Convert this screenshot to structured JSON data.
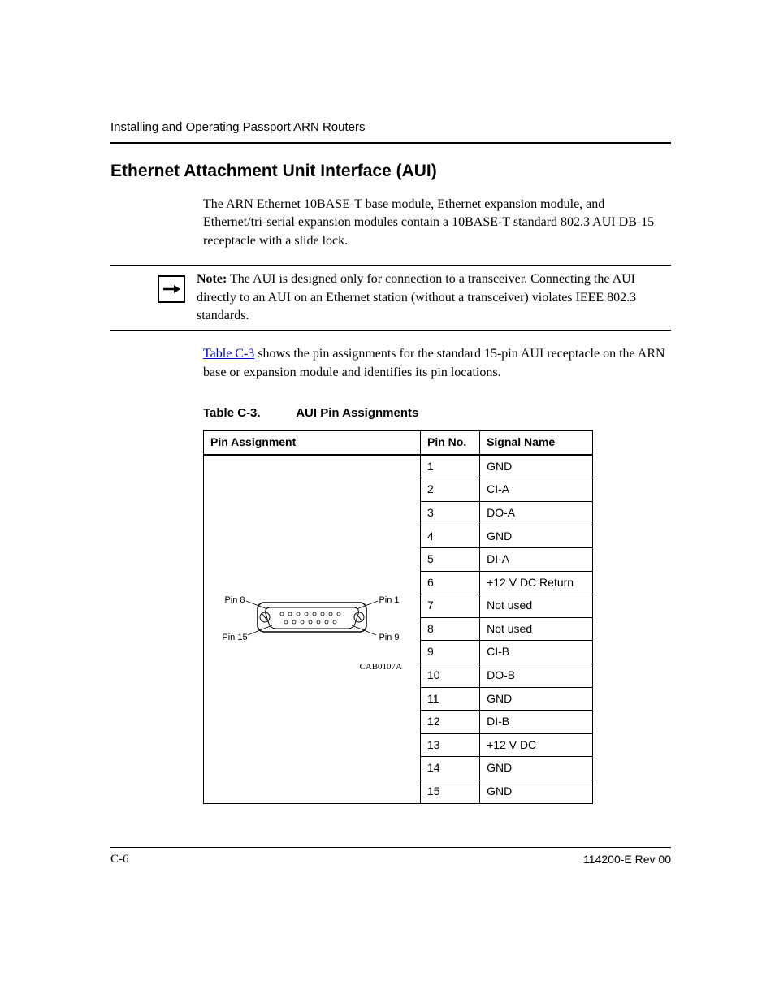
{
  "running_head": "Installing and Operating Passport ARN Routers",
  "section_title": "Ethernet Attachment Unit Interface (AUI)",
  "intro_paragraph": "The ARN Ethernet 10BASE-T base module, Ethernet expansion module, and Ethernet/tri-serial expansion modules contain a 10BASE-T standard 802.3 AUI DB-15 receptacle with a slide lock.",
  "note": {
    "label": "Note:",
    "text": " The AUI is designed only for connection to a transceiver. Connecting the AUI directly to an AUI on an Ethernet station (without a transceiver) violates IEEE 802.3 standards."
  },
  "xref_text": "Table C-3",
  "after_xref": " shows the pin assignments for the standard 15-pin AUI receptacle on the ARN base or expansion module and identifies its pin locations.",
  "table": {
    "caption_number": "Table C-3.",
    "caption_title": "AUI Pin Assignments",
    "headers": [
      "Pin Assignment",
      "Pin No.",
      "Signal Name"
    ],
    "rows": [
      {
        "pin": "1",
        "signal": "GND"
      },
      {
        "pin": "2",
        "signal": "CI-A"
      },
      {
        "pin": "3",
        "signal": "DO-A"
      },
      {
        "pin": "4",
        "signal": "GND"
      },
      {
        "pin": "5",
        "signal": "DI-A"
      },
      {
        "pin": "6",
        "signal": "+12 V DC Return"
      },
      {
        "pin": "7",
        "signal": "Not used"
      },
      {
        "pin": "8",
        "signal": "Not used"
      },
      {
        "pin": "9",
        "signal": "CI-B"
      },
      {
        "pin": "10",
        "signal": "DO-B"
      },
      {
        "pin": "11",
        "signal": "GND"
      },
      {
        "pin": "12",
        "signal": "DI-B"
      },
      {
        "pin": "13",
        "signal": "+12 V DC"
      },
      {
        "pin": "14",
        "signal": "GND"
      },
      {
        "pin": "15",
        "signal": "GND"
      }
    ],
    "diagram_labels": {
      "pin1": "Pin 1",
      "pin8": "Pin 8",
      "pin9": "Pin 9",
      "pin15": "Pin 15",
      "drawing_id": "CAB0107A"
    }
  },
  "footer": {
    "page_number": "C-6",
    "doc_rev": "114200-E Rev 00"
  }
}
